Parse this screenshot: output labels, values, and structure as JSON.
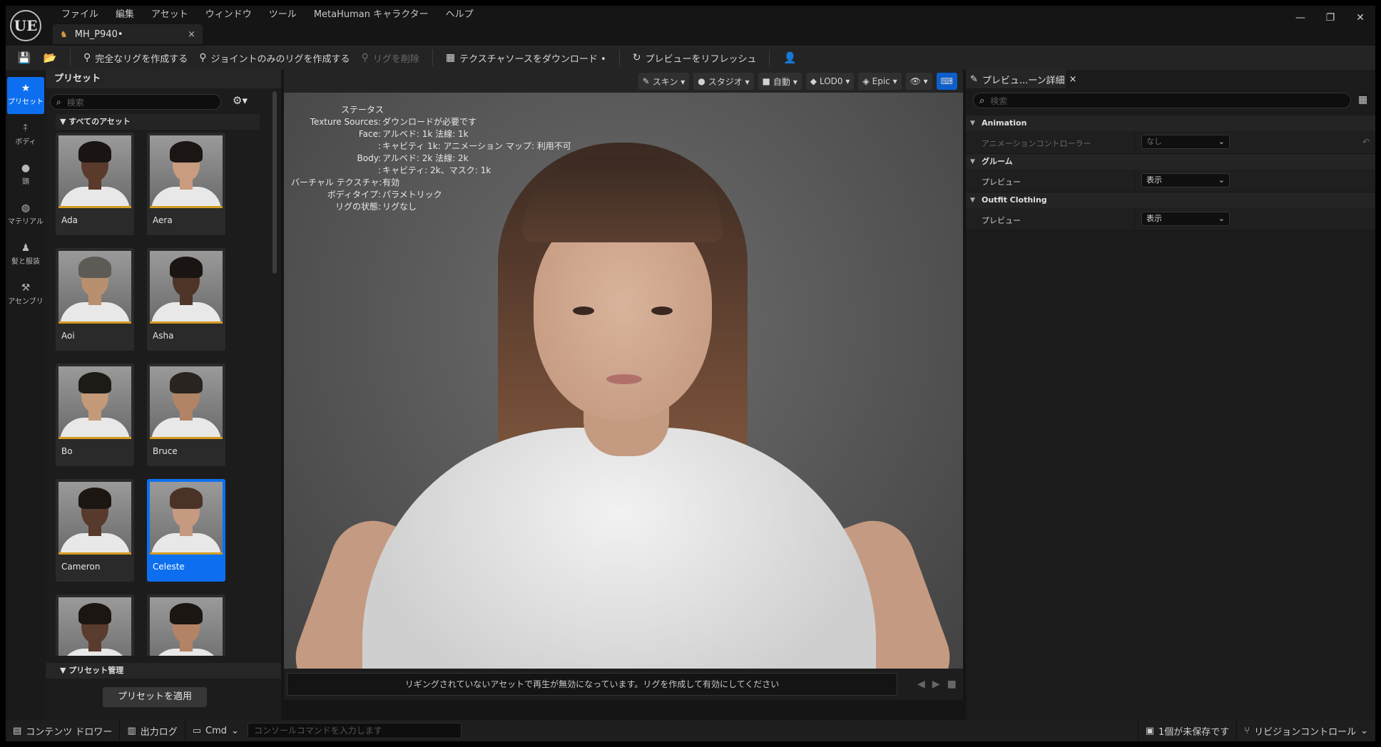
{
  "titlebar": {
    "logo": "UE",
    "menu": [
      "ファイル",
      "編集",
      "アセット",
      "ウィンドウ",
      "ツール",
      "MetaHuman キャラクター",
      "ヘルプ"
    ],
    "doc_tab": {
      "label": "MH_P940•",
      "icon": "character-icon",
      "close": "×"
    },
    "window_controls": [
      "—",
      "❐",
      "✕"
    ]
  },
  "toolbar": {
    "save_icon": "💾",
    "browse_icon": "📂",
    "buttons": [
      {
        "label": "完全なリグを作成する",
        "icon": "rig-icon"
      },
      {
        "label": "ジョイントのみのリグを作成する",
        "icon": "joint-rig-icon"
      },
      {
        "label": "リグを削除",
        "icon": "remove-rig-icon",
        "disabled": true
      },
      {
        "label": "テクスチャソースをダウンロード •",
        "icon": "texture-icon"
      },
      {
        "label": "プレビューをリフレッシュ",
        "icon": "refresh-icon"
      }
    ],
    "user_icon": "👤"
  },
  "modes": [
    {
      "label": "プリセット",
      "icon": "★",
      "active": true
    },
    {
      "label": "ボディ",
      "icon": "⤉"
    },
    {
      "label": "頭",
      "icon": "●"
    },
    {
      "label": "マテリアル",
      "icon": "◍"
    },
    {
      "label": "髪と服装",
      "icon": "♟"
    },
    {
      "label": "アセンブリ",
      "icon": "⚒"
    }
  ],
  "presets": {
    "title": "プリセット",
    "search_placeholder": "検索",
    "section": "すべてのアセット",
    "items": [
      {
        "name": "Ada",
        "skin": "#5a3a2b",
        "hair": "#1a1412"
      },
      {
        "name": "Aera",
        "skin": "#c99b7f",
        "hair": "#1b1614"
      },
      {
        "name": "Aoi",
        "skin": "#b8906f",
        "hair": "#5e5a55"
      },
      {
        "name": "Asha",
        "skin": "#4f3428",
        "hair": "#1a1412"
      },
      {
        "name": "Bo",
        "skin": "#c49a78",
        "hair": "#1e1a16"
      },
      {
        "name": "Bruce",
        "skin": "#b28466",
        "hair": "#2a2420"
      },
      {
        "name": "Cameron",
        "skin": "#573a2c",
        "hair": "#1c1613"
      },
      {
        "name": "Celeste",
        "skin": "#c69a80",
        "hair": "#4a3326",
        "selected": true
      },
      {
        "name": "",
        "skin": "#5a3c2e",
        "hair": "#1c1613"
      },
      {
        "name": "",
        "skin": "#b48366",
        "hair": "#1c1613"
      }
    ],
    "manage_section": "プリセット管理",
    "apply_button": "プリセットを適用"
  },
  "viewport": {
    "toolbar": [
      {
        "label": "スキン ▾",
        "icon": "brush-icon"
      },
      {
        "label": "スタジオ ▾",
        "icon": "light-icon"
      },
      {
        "label": "自動 ▾",
        "icon": "camera-icon"
      },
      {
        "label": "LOD0 ▾",
        "icon": "cube-icon"
      },
      {
        "label": "Epic ▾",
        "icon": "quality-icon"
      },
      {
        "label": "👁 ▾",
        "icon": "eye-icon"
      },
      {
        "label": "⌨",
        "icon": "keyboard-icon",
        "accent": true
      }
    ],
    "stats": {
      "title": "ステータス",
      "rows": [
        {
          "k": "Texture Sources:",
          "v": "ダウンロードが必要です"
        },
        {
          "k": "Face:",
          "v": "アルベド: 1k 法線: 1k"
        },
        {
          "k": ":",
          "v": "キャビティ 1k: アニメーション マップ: 利用不可"
        },
        {
          "k": "Body:",
          "v": "アルベド: 2k 法線: 2k"
        },
        {
          "k": ":",
          "v": "キャビティ: 2k、マスク: 1k"
        },
        {
          "k": "バーチャル テクスチャ:",
          "v": "有効"
        },
        {
          "k": "ボディタイプ:",
          "v": "パラメトリック"
        },
        {
          "k": "リグの状態:",
          "v": "リグなし"
        }
      ]
    },
    "status_message": "リギングされていないアセットで再生が無効になっています。リグを作成して有効にしてください",
    "transport": [
      "◀",
      "▶",
      "■"
    ]
  },
  "details": {
    "tab": "プレビュ...ーン詳細",
    "search_placeholder": "検索",
    "categories": [
      {
        "name": "Animation",
        "props": [
          {
            "label": "アニメーションコントローラー",
            "value": "なし",
            "disabled": true
          }
        ]
      },
      {
        "name": "グルーム",
        "props": [
          {
            "label": "プレビュー",
            "value": "表示"
          }
        ]
      },
      {
        "name": "Outfit Clothing",
        "props": [
          {
            "label": "プレビュー",
            "value": "表示"
          }
        ]
      }
    ]
  },
  "statusbar": {
    "content_drawer": "コンテンツ ドロワー",
    "output_log": "出力ログ",
    "cmd": "Cmd",
    "console_placeholder": "コンソールコマンドを入力します",
    "unsaved": "1個が未保存です",
    "revision": "リビジョンコントロール"
  }
}
